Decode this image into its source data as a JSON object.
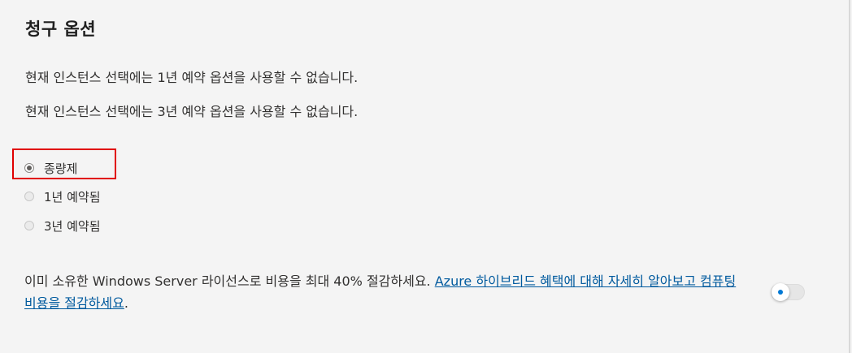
{
  "section": {
    "title": "청구 옵션"
  },
  "messages": [
    "현재 인스턴스 선택에는 1년 예약 옵션을 사용할 수 없습니다.",
    "현재 인스턴스 선택에는 3년 예약 옵션을 사용할 수 없습니다."
  ],
  "billing_options": [
    {
      "label": "종량제",
      "selected": true
    },
    {
      "label": "1년 예약됨",
      "selected": false
    },
    {
      "label": "3년 예약됨",
      "selected": false
    }
  ],
  "hybrid_benefit": {
    "text": "이미 소유한 Windows Server 라이선스로 비용을 최대 40% 절감하세요. ",
    "link_text": "Azure 하이브리드 혜택에 대해 자세히 알아보고 컴퓨팅 비용을 절감하세요",
    "suffix": ".",
    "toggle_on": false
  },
  "colors": {
    "highlight": "#e00000",
    "link": "#005a9e",
    "toggle_dot": "#0078d4"
  }
}
